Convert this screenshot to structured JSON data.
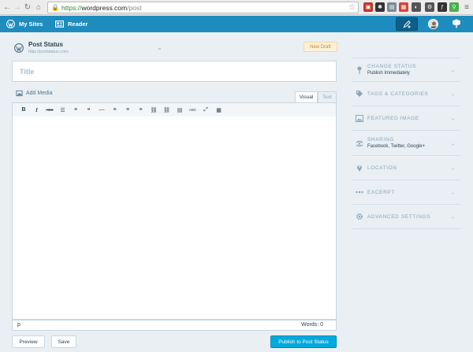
{
  "browser": {
    "url_scheme": "https://",
    "url_host": "wordpress.com",
    "url_path": "/post",
    "extensions": [
      {
        "name": "ext-1-icon",
        "color": "#c0392b"
      },
      {
        "name": "ext-2-icon",
        "color": "#333333"
      },
      {
        "name": "ext-3-icon",
        "color": "#7b8a96"
      },
      {
        "name": "ext-4-icon",
        "color": "#d34836"
      },
      {
        "name": "ext-5-icon",
        "color": "#555555"
      },
      {
        "name": "ext-6-icon",
        "color": "#555555"
      },
      {
        "name": "ext-7-icon",
        "color": "#333333"
      },
      {
        "name": "ext-8-icon",
        "color": "#4caf50"
      },
      {
        "name": "menu-icon",
        "color": "#666666"
      }
    ]
  },
  "masterbar": {
    "my_sites": "My Sites",
    "reader": "Reader"
  },
  "site": {
    "name": "Post Status",
    "url": "http://poststatus.com",
    "badge": "New Draft"
  },
  "editor": {
    "title_placeholder": "Title",
    "add_media": "Add Media",
    "tab_visual": "Visual",
    "tab_text": "Text",
    "path": "p",
    "word_count": "Words: 0",
    "toolbar": [
      {
        "name": "bold-button",
        "glyph": "B"
      },
      {
        "name": "italic-button",
        "glyph": "I"
      },
      {
        "name": "strikethrough-button",
        "glyph": "ABC"
      },
      {
        "name": "bulleted-list-button",
        "glyph": "☰"
      },
      {
        "name": "numbered-list-button",
        "glyph": "≡"
      },
      {
        "name": "blockquote-button",
        "glyph": "❝"
      },
      {
        "name": "horizontal-rule-button",
        "glyph": "—"
      },
      {
        "name": "align-left-button",
        "glyph": "≡"
      },
      {
        "name": "align-center-button",
        "glyph": "≡"
      },
      {
        "name": "align-right-button",
        "glyph": "≡"
      },
      {
        "name": "insert-link-button",
        "glyph": "⛓"
      },
      {
        "name": "remove-link-button",
        "glyph": "⛓"
      },
      {
        "name": "read-more-button",
        "glyph": "▤"
      },
      {
        "name": "spellcheck-button",
        "glyph": "ABC"
      },
      {
        "name": "fullscreen-button",
        "glyph": "⤢"
      },
      {
        "name": "toolbar-toggle-button",
        "glyph": "▦"
      }
    ]
  },
  "actions": {
    "preview": "Preview",
    "save": "Save",
    "publish": "Publish to Post Status"
  },
  "sidebar": {
    "items": [
      {
        "id": "change-status",
        "icon": "pin-icon",
        "title": "CHANGE STATUS",
        "subtitle": "Publish Immediately"
      },
      {
        "id": "tags-categories",
        "icon": "tag-icon",
        "title": "TAGS & CATEGORIES",
        "subtitle": ""
      },
      {
        "id": "featured-image",
        "icon": "image-icon",
        "title": "FEATURED IMAGE",
        "subtitle": ""
      },
      {
        "id": "sharing",
        "icon": "share-icon",
        "title": "SHARING",
        "subtitle": "Facebook, Twitter, Google+"
      },
      {
        "id": "location",
        "icon": "location-icon",
        "title": "LOCATION",
        "subtitle": ""
      },
      {
        "id": "excerpt",
        "icon": "ellipsis-icon",
        "title": "EXCERPT",
        "subtitle": ""
      },
      {
        "id": "advanced-settings",
        "icon": "gear-icon",
        "title": "ADVANCED SETTINGS",
        "subtitle": ""
      }
    ]
  },
  "colors": {
    "masterbar": "#1e8cbe",
    "publish": "#00aadc",
    "background": "#e9eff3"
  }
}
